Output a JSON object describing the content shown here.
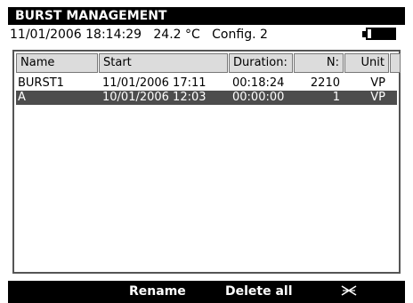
{
  "window": {
    "title": "BURST MANAGEMENT"
  },
  "status": {
    "datetime": "11/01/2006 18:14:29",
    "temperature": "24.2 °C",
    "config": "Config. 2",
    "battery_icon": "battery-icon"
  },
  "table": {
    "columns": [
      "Name",
      "Start",
      "Duration:",
      "N:",
      "Unit"
    ],
    "rows": [
      {
        "name": "BURST1",
        "start": "11/01/2006 17:11",
        "duration": "00:18:24",
        "n": "2210",
        "unit": "VP"
      },
      {
        "name": "A",
        "start": "10/01/2006 12:03",
        "duration": "00:00:00",
        "n": "1",
        "unit": "VP"
      }
    ],
    "selected_row": 1
  },
  "softkeys": {
    "rename": "Rename",
    "delete_all": "Delete all",
    "exit_icon": "close-x-icon"
  },
  "colors": {
    "bar": "#000000",
    "selected_row": "#4d4d4d",
    "header_cell": "#dcdcdc"
  }
}
